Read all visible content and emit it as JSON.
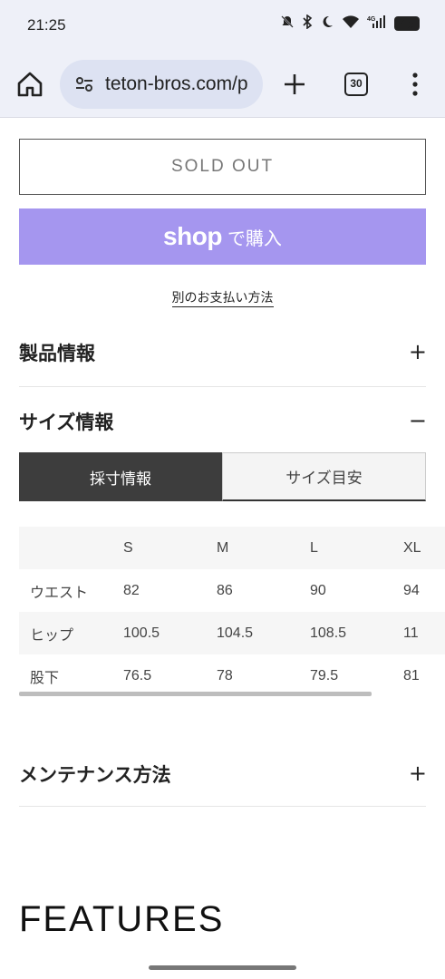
{
  "status": {
    "time": "21:25",
    "battery": "45",
    "icons": [
      "mute-icon",
      "bluetooth-icon",
      "do-not-disturb-icon",
      "wifi-icon",
      "signal-4g-icon",
      "battery-icon"
    ],
    "network_label": "4G"
  },
  "browser": {
    "url": "teton-bros.com/p",
    "tab_count": "30"
  },
  "purchase": {
    "sold_out_label": "SOLD OUT",
    "shop_logo": "shop",
    "shop_suffix": "で購入",
    "shop_color": "#a596ef",
    "alt_payment": "別のお支払い方法"
  },
  "accordions": {
    "product_info": {
      "title": "製品情報",
      "toggle": "+"
    },
    "size_info": {
      "title": "サイズ情報",
      "toggle": "−"
    },
    "maintenance": {
      "title": "メンテナンス方法",
      "toggle": "+"
    }
  },
  "size_tabs": {
    "active": "採寸情報",
    "inactive": "サイズ目安"
  },
  "size_table": {
    "headers": [
      "",
      "S",
      "M",
      "L",
      "XL"
    ],
    "rows": [
      [
        "ウエスト",
        "82",
        "86",
        "90",
        "94"
      ],
      [
        "ヒップ",
        "100.5",
        "104.5",
        "108.5",
        "11"
      ],
      [
        "股下",
        "76.5",
        "78",
        "79.5",
        "81"
      ]
    ]
  },
  "features_heading": "FEATURES"
}
